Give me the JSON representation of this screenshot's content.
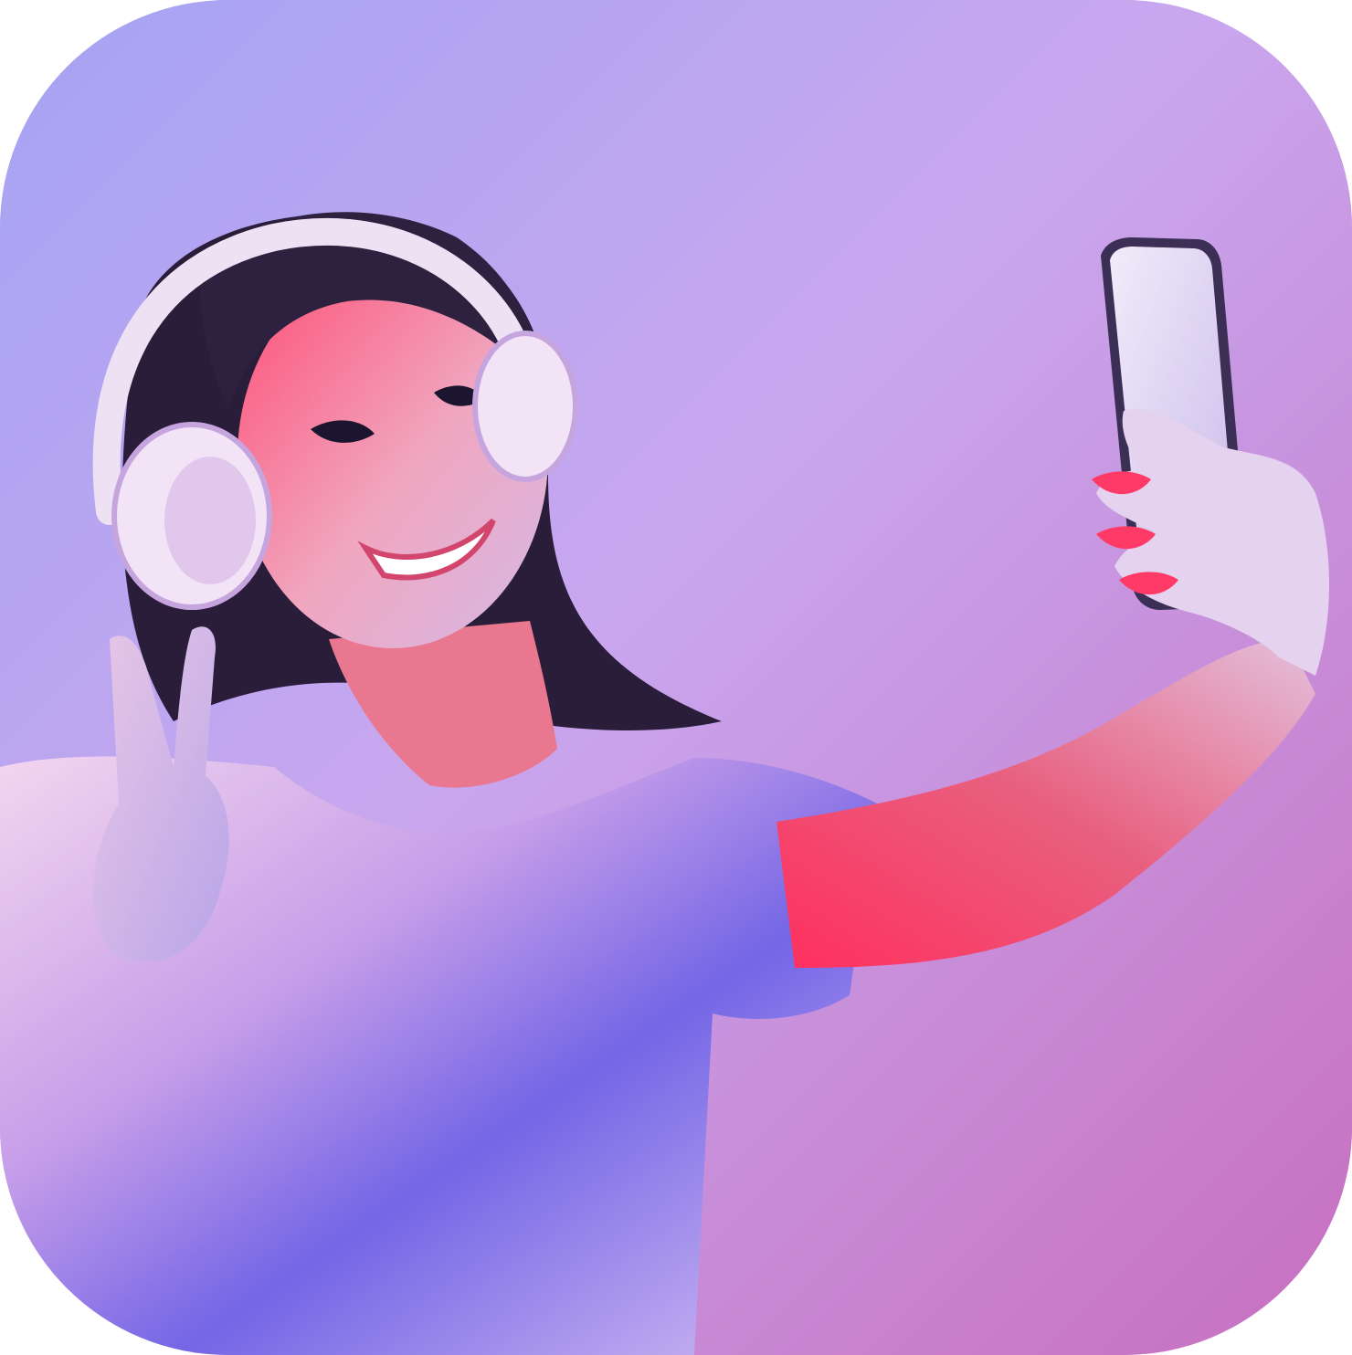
{
  "photo": {
    "subject": "woman-taking-selfie",
    "icons": {
      "headphones": "headphones-icon",
      "phone": "smartphone-icon",
      "hand": "peace-sign-icon"
    },
    "colors": {
      "background_left": "#a9a6f2",
      "background_right": "#c877c2",
      "shirt": "#e9d6f2",
      "shirt_shadow": "#6f63e0",
      "skin_red_light": "#ff3d6e",
      "skin": "#f2b9c9",
      "hair": "#2a1d3a",
      "headphones": "#efe1f4",
      "phone_screen": "#e7dcf4",
      "phone_body": "#3b2f55"
    }
  }
}
